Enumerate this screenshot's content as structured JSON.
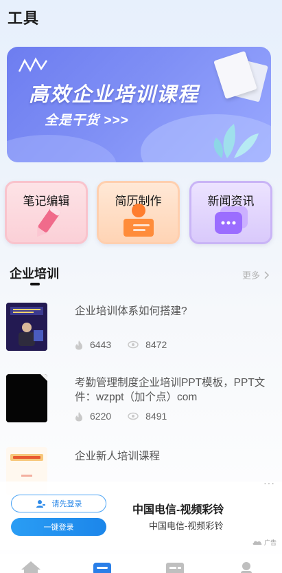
{
  "header": {
    "title": "工具"
  },
  "banner": {
    "headline": "高效企业培训课程",
    "subline": "全是干货 >>>"
  },
  "tools": [
    {
      "label": "笔记编辑",
      "icon": "pencil-icon"
    },
    {
      "label": "简历制作",
      "icon": "resume-icon"
    },
    {
      "label": "新闻资讯",
      "icon": "chat-bubble-icon"
    }
  ],
  "section": {
    "title": "企业培训",
    "more_label": "更多"
  },
  "articles": [
    {
      "title": "企业培训体系如何搭建?",
      "likes": "6443",
      "views": "8472"
    },
    {
      "title": "考勤管理制度企业培训PPT模板，PPT文件：wzppt（加个点）com",
      "likes": "6220",
      "views": "8491"
    },
    {
      "title": "企业新人培训课程"
    }
  ],
  "ad": {
    "login_first": "请先登录",
    "one_click_login": "一键登录",
    "carrier_title": "中国电信-视频彩铃",
    "carrier_subtitle": "中国电信-视频彩铃",
    "more_dots": "···",
    "ad_label": "广告"
  },
  "nav": [
    {
      "icon": "home-icon"
    },
    {
      "icon": "tools-icon",
      "active": true
    },
    {
      "icon": "news-icon"
    },
    {
      "icon": "profile-icon"
    }
  ],
  "colors": {
    "accent": "#2a9df4",
    "banner": "#7f8ff5",
    "active_nav": "#2a7fe8"
  }
}
